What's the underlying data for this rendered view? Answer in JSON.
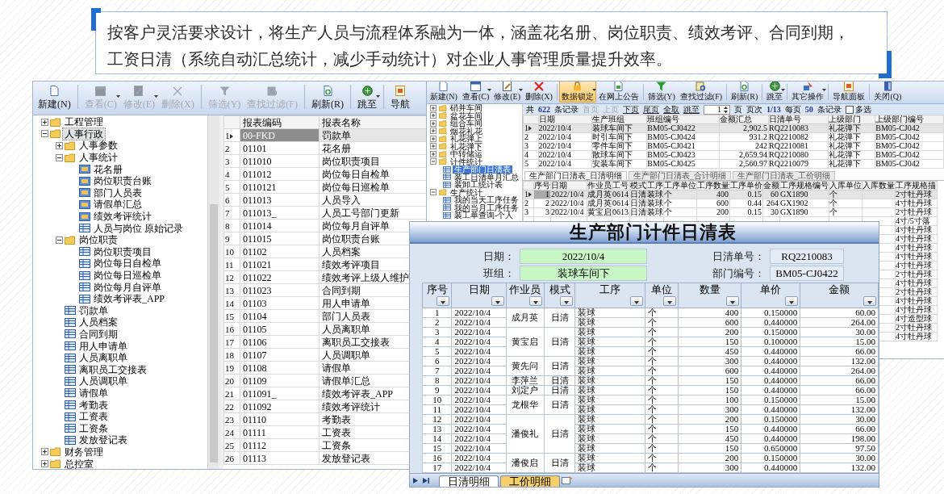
{
  "banner": {
    "lines": [
      "按客户灵活要求设计，将生产人员与流程体系融为一体，涵盖花名册、岗位职责、绩效考评、合同到期，",
      "工资日清（系统自动汇总统计，减少手动统计）对企业人事管理质量提升效率。"
    ]
  },
  "report_window": {
    "toolbar": [
      {
        "label": "新建(N)",
        "disabled": false,
        "dropdown": false
      },
      {
        "label": "查看(C)",
        "disabled": true,
        "dropdown": true
      },
      {
        "label": "修改(E)",
        "disabled": true,
        "dropdown": true
      },
      {
        "label": "删除(X)",
        "disabled": true,
        "dropdown": false
      },
      {
        "label": "筛选(Y)",
        "disabled": true,
        "dropdown": false
      },
      {
        "label": "查找过滤(F)",
        "disabled": true,
        "dropdown": false
      },
      {
        "label": "刷新(R)",
        "disabled": false,
        "dropdown": false
      },
      {
        "label": "跳至",
        "disabled": false,
        "dropdown": true
      },
      {
        "label": "导航",
        "disabled": false,
        "dropdown": false
      }
    ],
    "tree": [
      {
        "label": "工程管理",
        "kind": "folder",
        "expanded": false,
        "selected": false
      },
      {
        "label": "人事行政",
        "kind": "folder",
        "expanded": true,
        "selected": true,
        "children": [
          {
            "label": "人事参数",
            "kind": "folder",
            "expanded": false,
            "selected": false
          },
          {
            "label": "人事统计",
            "kind": "folder",
            "expanded": true,
            "selected": false,
            "children": [
              {
                "label": "花名册",
                "kind": "chart",
                "selected": false
              },
              {
                "label": "岗位职责台账",
                "kind": "chart",
                "selected": false
              },
              {
                "label": "部门人员表",
                "kind": "chart",
                "selected": false
              },
              {
                "label": "请假单汇总",
                "kind": "chart",
                "selected": false
              },
              {
                "label": "绩效考评统计",
                "kind": "chart",
                "selected": false
              },
              {
                "label": "人员与岗位 原始记录",
                "kind": "table",
                "selected": false
              }
            ]
          },
          {
            "label": "岗位职责",
            "kind": "folder",
            "expanded": true,
            "selected": false,
            "children": [
              {
                "label": "岗位职责项目",
                "kind": "table",
                "selected": false
              },
              {
                "label": "岗位每日自检单",
                "kind": "table",
                "selected": false
              },
              {
                "label": "岗位每日巡检单",
                "kind": "table",
                "selected": false
              },
              {
                "label": "岗位每月自评单",
                "kind": "table",
                "selected": false
              },
              {
                "label": "绩效考评表_APP",
                "kind": "table",
                "selected": false
              }
            ]
          },
          {
            "label": "罚款单",
            "kind": "table",
            "selected": false
          },
          {
            "label": "人员档案",
            "kind": "table",
            "selected": false
          },
          {
            "label": "合同到期",
            "kind": "table",
            "selected": false
          },
          {
            "label": "用人申请单",
            "kind": "table",
            "selected": false
          },
          {
            "label": "人员离职单",
            "kind": "table",
            "selected": false
          },
          {
            "label": "离职员工交接表",
            "kind": "table",
            "selected": false
          },
          {
            "label": "人员调职单",
            "kind": "table",
            "selected": false
          },
          {
            "label": "请假单",
            "kind": "table",
            "selected": false
          },
          {
            "label": "考勤表",
            "kind": "table",
            "selected": false
          },
          {
            "label": "工资表",
            "kind": "table",
            "selected": false
          },
          {
            "label": "工资条",
            "kind": "table",
            "selected": false
          },
          {
            "label": "发放登记表",
            "kind": "table",
            "selected": false
          }
        ]
      },
      {
        "label": "财务管理",
        "kind": "folder",
        "expanded": false,
        "selected": false
      },
      {
        "label": "总控室",
        "kind": "folder",
        "expanded": false,
        "selected": false
      }
    ],
    "grid": {
      "columns": [
        "报表编码",
        "报表名称"
      ],
      "rows": [
        {
          "num": "1",
          "code": "00-FKD",
          "name": "罚款单",
          "selected": true
        },
        {
          "num": "2",
          "code": "01101",
          "name": "花名册",
          "selected": false
        },
        {
          "num": "3",
          "code": "011010",
          "name": "岗位职责项目",
          "selected": false
        },
        {
          "num": "4",
          "code": "011012",
          "name": "岗位每日自检单",
          "selected": false
        },
        {
          "num": "5",
          "code": "0110121",
          "name": "岗位每日巡检单",
          "selected": false
        },
        {
          "num": "6",
          "code": "011013",
          "name": "人员导入",
          "selected": false
        },
        {
          "num": "7",
          "code": "011013_",
          "name": "人员工号部门更新",
          "selected": false
        },
        {
          "num": "8",
          "code": "011014",
          "name": "岗位每月自评单",
          "selected": false
        },
        {
          "num": "9",
          "code": "011015",
          "name": "岗位职责台账",
          "selected": false
        },
        {
          "num": "10",
          "code": "01102",
          "name": "人员档案",
          "selected": false
        },
        {
          "num": "11",
          "code": "011021",
          "name": "绩效考评项目",
          "selected": false
        },
        {
          "num": "12",
          "code": "011022",
          "name": "绩效考评上级人维护",
          "selected": false
        },
        {
          "num": "13",
          "code": "011023",
          "name": "合同到期",
          "selected": false
        },
        {
          "num": "14",
          "code": "01103",
          "name": "用人申请单",
          "selected": false
        },
        {
          "num": "15",
          "code": "01104",
          "name": "部门人员表",
          "selected": false
        },
        {
          "num": "16",
          "code": "01105",
          "name": "人员离职单",
          "selected": false
        },
        {
          "num": "17",
          "code": "01106",
          "name": "离职员工交接表",
          "selected": false
        },
        {
          "num": "18",
          "code": "01107",
          "name": "人员调职单",
          "selected": false
        },
        {
          "num": "19",
          "code": "01108",
          "name": "请假单",
          "selected": false
        },
        {
          "num": "20",
          "code": "01109",
          "name": "请假单汇总",
          "selected": false
        },
        {
          "num": "21",
          "code": "011091_",
          "name": "绩效考评表_APP",
          "selected": false
        },
        {
          "num": "22",
          "code": "011092",
          "name": "绩效考评统计",
          "selected": false
        },
        {
          "num": "23",
          "code": "01110",
          "name": "考勤表",
          "selected": false
        },
        {
          "num": "24",
          "code": "01111",
          "name": "工资表",
          "selected": false
        },
        {
          "num": "25",
          "code": "01112",
          "name": "工资条",
          "selected": false
        },
        {
          "num": "26",
          "code": "01113",
          "name": "发放登记表",
          "selected": false
        }
      ]
    }
  },
  "daily_window": {
    "toolbar": [
      {
        "label": "新建(N)",
        "active": false,
        "dropdown": false
      },
      {
        "label": "查看(C)",
        "active": false,
        "dropdown": true
      },
      {
        "label": "修改(E)",
        "active": false,
        "dropdown": true
      },
      {
        "label": "删除(X)",
        "active": false,
        "dropdown": false
      },
      {
        "label": "数据锁定",
        "active": true,
        "dropdown": true
      },
      {
        "label": "在网上公告",
        "active": false,
        "dropdown": false
      },
      {
        "label": "筛选(Y)",
        "active": false,
        "dropdown": false
      },
      {
        "label": "查找过滤(F)",
        "active": false,
        "dropdown": false
      },
      {
        "label": "刷新(R)",
        "active": false,
        "dropdown": false
      },
      {
        "label": "跳至",
        "active": false,
        "dropdown": true
      },
      {
        "label": "其它操作",
        "active": false,
        "dropdown": true
      },
      {
        "label": "导航面板",
        "active": false,
        "dropdown": false
      },
      {
        "label": "关闭(Q)",
        "active": false,
        "dropdown": false
      }
    ],
    "tree": [
      {
        "label": "硝并车间",
        "kind": "folder",
        "expanded": false,
        "selected": false
      },
      {
        "label": "盆花车间",
        "kind": "folder",
        "expanded": false,
        "selected": false
      },
      {
        "label": "组合车间",
        "kind": "folder",
        "expanded": false,
        "selected": false
      },
      {
        "label": "烟花礼花",
        "kind": "folder",
        "expanded": false,
        "selected": false
      },
      {
        "label": "礼花弹上",
        "kind": "folder",
        "expanded": false,
        "selected": false
      },
      {
        "label": "礼花弹下",
        "kind": "folder",
        "expanded": false,
        "selected": false
      },
      {
        "label": "中转储运",
        "kind": "folder",
        "expanded": false,
        "selected": false
      },
      {
        "label": "计件统计",
        "kind": "folder",
        "expanded": true,
        "selected": false,
        "children": [
          {
            "label": "生产部门日清表",
            "kind": "table",
            "selected": true
          },
          {
            "label": "装工日清单月汇总",
            "kind": "table",
            "selected": false
          },
          {
            "label": "装卸工统计表",
            "kind": "table",
            "selected": false
          }
        ]
      },
      {
        "label": "生产统计",
        "kind": "folder",
        "expanded": true,
        "selected": false,
        "children": [
          {
            "label": "我的当天工序任务",
            "kind": "table",
            "selected": false
          },
          {
            "label": "我的当月工序任务",
            "kind": "table",
            "selected": false
          },
          {
            "label": "装工单查询-个人",
            "kind": "table",
            "selected": false
          }
        ]
      }
    ],
    "pager": [
      {
        "text": "共",
        "kind": "label"
      },
      {
        "text": "622",
        "kind": "count"
      },
      {
        "text": "条记录",
        "kind": "label"
      },
      {
        "text": "首页",
        "kind": "link",
        "disabled": true
      },
      {
        "text": "上页",
        "kind": "link",
        "disabled": true
      },
      {
        "text": "下页",
        "kind": "link",
        "disabled": false
      },
      {
        "text": "尾页",
        "kind": "link",
        "disabled": false
      },
      {
        "text": "全取",
        "kind": "link",
        "disabled": false
      },
      {
        "text": "跳至",
        "kind": "link",
        "disabled": false
      },
      {
        "text": "1",
        "kind": "spin"
      },
      {
        "text": "页",
        "kind": "label"
      },
      {
        "text": "页次",
        "kind": "label"
      },
      {
        "text": "1/13",
        "kind": "count"
      },
      {
        "text": "每页",
        "kind": "label"
      },
      {
        "text": "50",
        "kind": "count"
      },
      {
        "text": "条记录",
        "kind": "label"
      },
      {
        "text": "多选",
        "kind": "check",
        "checked": false
      }
    ],
    "grid": {
      "columns": [
        "日期",
        "生产班组",
        "班组编号",
        "金额汇总",
        "日清单号",
        "上级部门",
        "上级部门编号"
      ],
      "rows": [
        {
          "num": "1",
          "cells": [
            "2022/10/4",
            "装球车间下",
            "BM05-CJ0422",
            "2,902.5",
            "RQ2210083",
            "礼花弹下",
            "BM05-CJ042"
          ],
          "selected": true
        },
        {
          "num": "2",
          "cells": [
            "2022/10/4",
            "时引车间下",
            "BM05-CJ0424",
            "931.2",
            "RQ2210082",
            "礼花弹下",
            "BM05-CJ042"
          ],
          "selected": false
        },
        {
          "num": "3",
          "cells": [
            "2022/10/4",
            "零件车间下",
            "BM05-CJ0421",
            "242",
            "RQ2210081",
            "礼花弹下",
            "BM05-CJ042"
          ],
          "selected": false
        },
        {
          "num": "4",
          "cells": [
            "2022/10/4",
            "散球车间下",
            "BM05-CJ0423",
            "2,659.94",
            "RQ2210080",
            "礼花弹下",
            "BM05-CJ042"
          ],
          "selected": false
        },
        {
          "num": "5",
          "cells": [
            "2022/10/4",
            "安装车间下",
            "BM05-CJ0425",
            "2,560.97",
            "RQ2210079",
            "礼花弹下",
            "BM05-CJ042"
          ],
          "selected": false
        }
      ]
    },
    "tabs": [
      {
        "label": "生产部门日清表_日清明细",
        "selected": true
      },
      {
        "label": "生产部门日清表_合计明细",
        "selected": false
      },
      {
        "label": "生产部门日清表_工价明细",
        "selected": false
      }
    ],
    "detail": {
      "columns": [
        "序号",
        "日期",
        "作业员",
        "工号",
        "模式",
        "工序",
        "工序单位",
        "工序数量",
        "工序单价",
        "金额",
        "工序规格编号",
        "入库单位",
        "入库数量",
        "工序规格描"
      ],
      "rows": [
        {
          "num": "1",
          "seq": "1",
          "date": "2022/10/4",
          "worker": "成月英",
          "id": "0614",
          "mode": "日清",
          "process": "装球",
          "unit": "个",
          "qty": "400",
          "price": "0.15",
          "amount": "60",
          "spec_code": "GX1890",
          "stock_unit": "个",
          "spec": "2寸牡丹球",
          "selected": true
        },
        {
          "num": "2",
          "seq": "2",
          "date": "2022/10/4",
          "worker": "成月英",
          "id": "0614",
          "mode": "日清",
          "process": "装球",
          "unit": "个",
          "qty": "600",
          "price": "0.44",
          "amount": "264",
          "spec_code": "GX1902",
          "stock_unit": "个",
          "spec": "4寸牡丹球",
          "selected": false
        },
        {
          "num": "3",
          "seq": "3",
          "date": "2022/10/4",
          "worker": "黄宝启",
          "id": "0613",
          "mode": "日清",
          "process": "装球",
          "unit": "个",
          "qty": "200",
          "price": "0.15",
          "amount": "30",
          "spec_code": "GX1890",
          "stock_unit": "个",
          "spec": "2寸牡丹球",
          "selected": false
        },
        {
          "spec": "4寸/5寸落",
          "selected": false
        },
        {
          "spec": "4寸牡丹球",
          "selected": false
        },
        {
          "spec": "4寸牡丹球",
          "selected": false
        },
        {
          "spec": "4寸牡丹球",
          "selected": false
        },
        {
          "spec": "4寸牡丹球",
          "selected": false
        },
        {
          "spec": "4寸牡丹球",
          "selected": false
        },
        {
          "spec": "2寸牡丹球",
          "selected": false
        },
        {
          "spec": "4寸牡丹球",
          "selected": false
        },
        {
          "spec": "2寸牡丹球",
          "selected": false
        },
        {
          "spec": "4寸牡丹球",
          "selected": false
        },
        {
          "spec": "4寸牡丹球",
          "selected": false
        },
        {
          "spec": "4寸造型球",
          "selected": false
        },
        {
          "spec": "2寸牡丹球",
          "selected": false
        },
        {
          "spec": "4寸牡丹球",
          "selected": false
        }
      ]
    }
  },
  "sheet": {
    "title": "生产部门计件日清表",
    "fields": [
      {
        "label": "日期：",
        "value": "2022/10/4",
        "kind": "highlight"
      },
      {
        "label": "日清单号：",
        "value": "RQ2210083",
        "kind": "plain"
      },
      {
        "label": "班组：",
        "value": "装球车间下",
        "kind": "highlight"
      },
      {
        "label": "部门编号：",
        "value": "BM05-CJ0422",
        "kind": "plain"
      }
    ],
    "columns": [
      "序号",
      "日期",
      "作业员",
      "模式",
      "工序",
      "单位",
      "数量",
      "单价",
      "金额"
    ],
    "groups": [
      {
        "worker": "成月英",
        "mode": "日清",
        "rows": [
          {
            "seq": "1",
            "date": "2022/10/4",
            "process": "装球",
            "unit": "个",
            "qty": "400",
            "price": "0.150000",
            "amount": "60.00"
          },
          {
            "seq": "2",
            "date": "2022/10/4",
            "process": "装球",
            "unit": "个",
            "qty": "600",
            "price": "0.440000",
            "amount": "264.00"
          }
        ]
      },
      {
        "worker": "黄宝启",
        "mode": "日清",
        "rows": [
          {
            "seq": "3",
            "date": "2022/10/4",
            "process": "装球",
            "unit": "个",
            "qty": "200",
            "price": "0.150000",
            "amount": "30.00"
          },
          {
            "seq": "4",
            "date": "2022/10/4",
            "process": "装球",
            "unit": "个",
            "qty": "150",
            "price": "0.100000",
            "amount": "15.00"
          },
          {
            "seq": "5",
            "date": "2022/10/4",
            "process": "装球",
            "unit": "个",
            "qty": "450",
            "price": "0.440000",
            "amount": "66.00"
          }
        ]
      },
      {
        "worker": "黄先问",
        "mode": "日清",
        "rows": [
          {
            "seq": "6",
            "date": "2022/10/4",
            "process": "装球",
            "unit": "个",
            "qty": "300",
            "price": "0.440000",
            "amount": "132.00"
          },
          {
            "seq": "7",
            "date": "2022/10/4",
            "process": "装球",
            "unit": "个",
            "qty": "600",
            "price": "0.440000",
            "amount": "264.00"
          }
        ]
      },
      {
        "worker": "李萍兰",
        "mode": "日清",
        "rows": [
          {
            "seq": "8",
            "date": "2022/10/4",
            "process": "装球",
            "unit": "个",
            "qty": "150",
            "price": "0.440000",
            "amount": "66.00"
          }
        ]
      },
      {
        "worker": "刘定户",
        "mode": "日清",
        "rows": [
          {
            "seq": "9",
            "date": "2022/10/4",
            "process": "装球",
            "unit": "个",
            "qty": "150",
            "price": "0.440000",
            "amount": "66.00"
          }
        ]
      },
      {
        "worker": "龙根华",
        "mode": "日清",
        "rows": [
          {
            "seq": "10",
            "date": "2022/10/4",
            "process": "装球",
            "unit": "个",
            "qty": "100",
            "price": "0.150000",
            "amount": "15.00"
          },
          {
            "seq": "11",
            "date": "2022/10/4",
            "process": "装球",
            "unit": "个",
            "qty": "300",
            "price": "0.440000",
            "amount": "132.00"
          }
        ]
      },
      {
        "worker": "潘俊礼",
        "mode": "日清",
        "rows": [
          {
            "seq": "12",
            "date": "2022/10/4",
            "process": "装球",
            "unit": "个",
            "qty": "200",
            "price": "0.150000",
            "amount": "30.00"
          },
          {
            "seq": "13",
            "date": "2022/10/4",
            "process": "装球",
            "unit": "个",
            "qty": "150",
            "price": "0.440000",
            "amount": "66.00"
          },
          {
            "seq": "14",
            "date": "2022/10/4",
            "process": "装球",
            "unit": "个",
            "qty": "450",
            "price": "0.440000",
            "amount": "198.00"
          },
          {
            "seq": "15",
            "date": "2022/10/4",
            "process": "装球",
            "unit": "个",
            "qty": "150",
            "price": "0.650000",
            "amount": "97.50"
          }
        ]
      },
      {
        "worker": "潘俊启",
        "mode": "日清",
        "rows": [
          {
            "seq": "16",
            "date": "2022/10/4",
            "process": "装球",
            "unit": "个",
            "qty": "200",
            "price": "0.150000",
            "amount": "30.00"
          },
          {
            "seq": "17",
            "date": "2022/10/4",
            "process": "装球",
            "unit": "个",
            "qty": "300",
            "price": "0.440000",
            "amount": "132.00"
          }
        ]
      }
    ],
    "tabs": [
      {
        "label": "日清明细",
        "selected": false
      },
      {
        "label": "工价明细",
        "selected": true
      }
    ]
  }
}
